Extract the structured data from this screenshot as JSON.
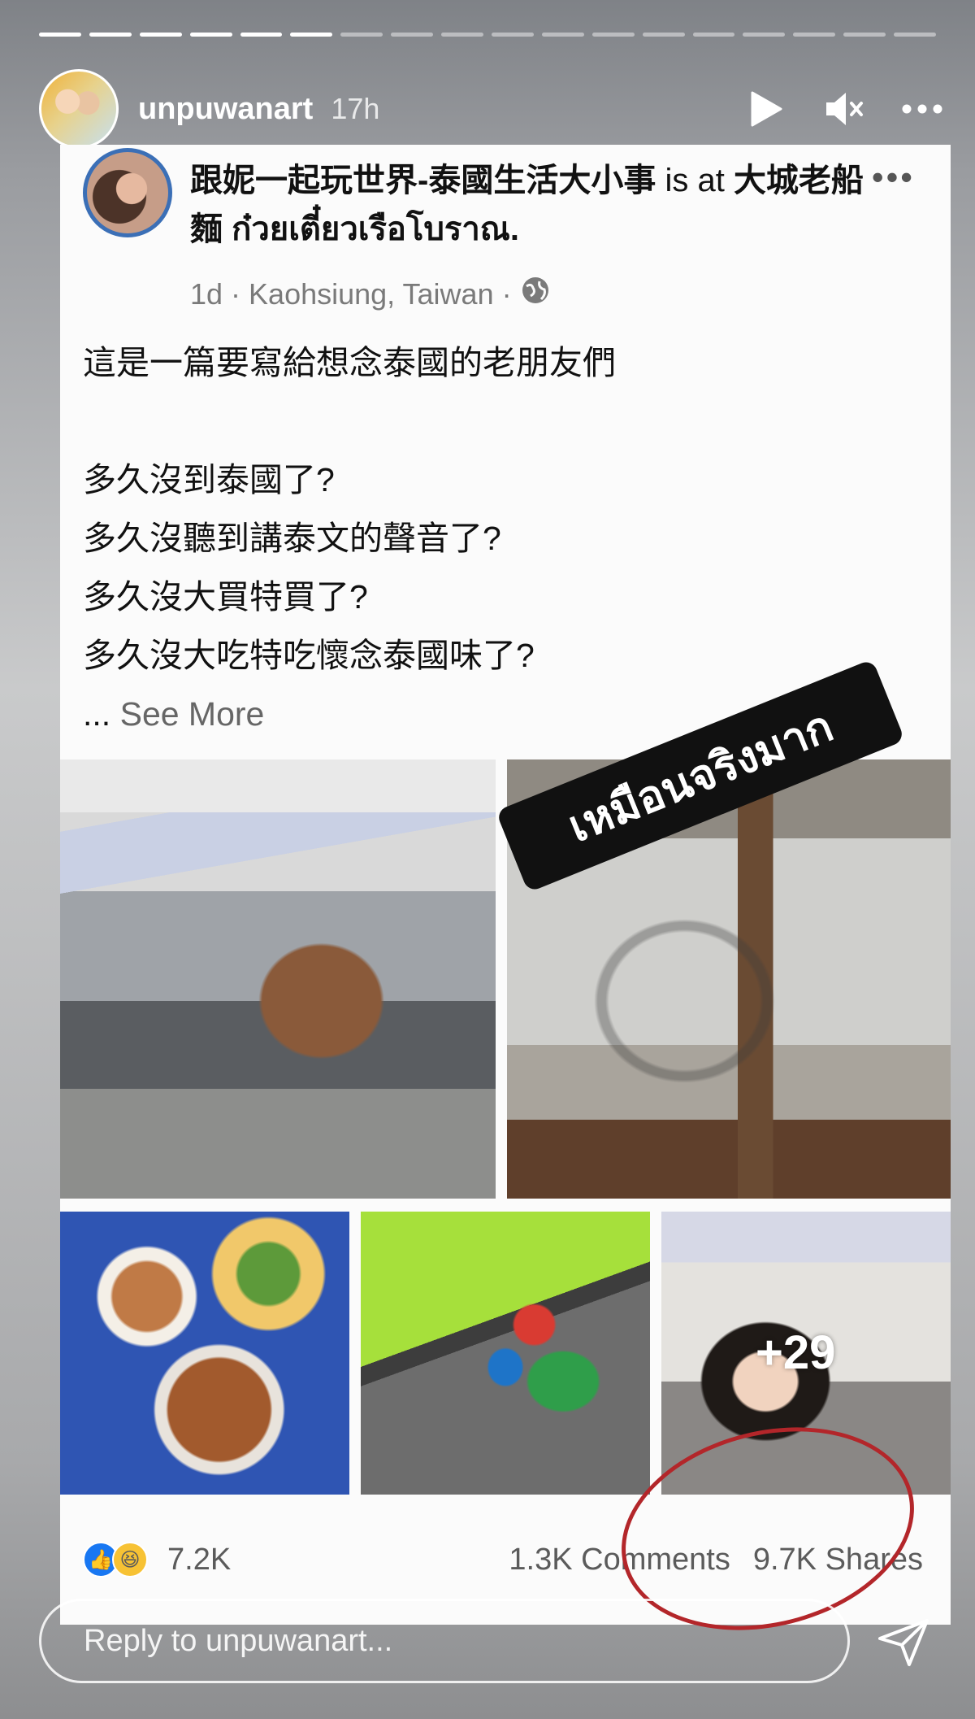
{
  "story": {
    "progress": {
      "segments_total": 18,
      "segments_completed": 6
    },
    "username": "unpuwanart",
    "time_ago": "17h",
    "icons": {
      "play": "play-icon",
      "mute": "mute-icon",
      "more": "more-options-icon"
    }
  },
  "post": {
    "page_name": "跟妮一起玩世界-泰國生活大小事",
    "is_at": "is at",
    "place": "大城老船麵 ก๋วยเตี๋ยวเรือโบราณ.",
    "suffix": "",
    "age": "1d",
    "location": "Kaohsiung, Taiwan",
    "privacy_icon": "globe-icon",
    "more": "•••",
    "lines": [
      "這是一篇要寫給想念泰國的老朋友們",
      "",
      "多久沒到泰國了?",
      "多久沒聽到講泰文的聲音了?",
      "多久沒大買特買了?",
      "多久沒大吃特吃懷念泰國味了?"
    ],
    "ellipsis": "...",
    "see_more": "See More",
    "photos_extra_count": "+29",
    "sticker_text": "เหมือนจริงมาก",
    "reaction_count": "7.2K",
    "comments": "1.3K Comments",
    "shares": "9.7K Shares"
  },
  "reply": {
    "placeholder": "Reply to unpuwanart..."
  },
  "colors": {
    "like_blue": "#1877f2",
    "annotation_red": "#b3262a",
    "sticker_bg": "#111111"
  }
}
